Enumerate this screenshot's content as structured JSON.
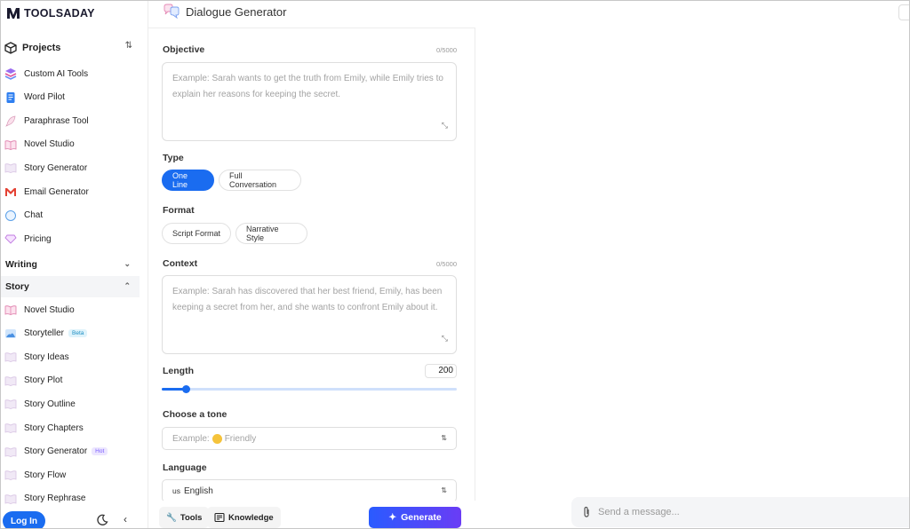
{
  "brand": {
    "name": "TOOLSADAY"
  },
  "header": {
    "title": "Dialogue Generator"
  },
  "sidebar": {
    "projects_label": "Projects",
    "items": [
      {
        "label": "Custom AI Tools",
        "icon": "layers-icon"
      },
      {
        "label": "Word Pilot",
        "icon": "document-icon"
      },
      {
        "label": "Paraphrase Tool",
        "icon": "feather-icon"
      },
      {
        "label": "Novel Studio",
        "icon": "open-book-icon"
      },
      {
        "label": "Story Generator",
        "icon": "book-icon"
      },
      {
        "label": "Email Generator",
        "icon": "gmail-icon"
      },
      {
        "label": "Chat",
        "icon": "chat-bubble-icon"
      },
      {
        "label": "Pricing",
        "icon": "diamond-icon"
      }
    ],
    "sections": [
      {
        "label": "Writing",
        "expanded": false
      },
      {
        "label": "Story",
        "expanded": true
      }
    ],
    "story_items": [
      {
        "label": "Novel Studio",
        "icon": "open-book-icon",
        "badge": ""
      },
      {
        "label": "Storyteller",
        "icon": "storyteller-icon",
        "badge": "Beta"
      },
      {
        "label": "Story Ideas",
        "icon": "book-icon",
        "badge": ""
      },
      {
        "label": "Story Plot",
        "icon": "book-icon",
        "badge": ""
      },
      {
        "label": "Story Outline",
        "icon": "book-icon",
        "badge": ""
      },
      {
        "label": "Story Chapters",
        "icon": "book-icon",
        "badge": ""
      },
      {
        "label": "Story Generator",
        "icon": "book-icon",
        "badge": "Hot"
      },
      {
        "label": "Story Flow",
        "icon": "book-icon",
        "badge": ""
      },
      {
        "label": "Story Rephrase",
        "icon": "book-icon",
        "badge": ""
      }
    ],
    "login_label": "Log In"
  },
  "form": {
    "objective": {
      "label": "Objective",
      "counter": "0/5000",
      "placeholder": "Example: Sarah wants to get the truth from Emily, while Emily tries to explain her reasons for keeping the secret."
    },
    "type": {
      "label": "Type",
      "options": [
        "One Line",
        "Full Conversation"
      ],
      "selected": "One Line"
    },
    "format": {
      "label": "Format",
      "options": [
        "Script Format",
        "Narrative Style"
      ]
    },
    "context": {
      "label": "Context",
      "counter": "0/5000",
      "placeholder": "Example: Sarah has discovered that her best friend, Emily, has been keeping a secret from her, and she wants to confront Emily about it."
    },
    "length": {
      "label": "Length",
      "value": "200",
      "fraction": 0.08
    },
    "tone": {
      "label": "Choose a tone",
      "placeholder_prefix": "Example:",
      "placeholder_value": "Friendly"
    },
    "language": {
      "label": "Language",
      "code": "us",
      "value": "English"
    }
  },
  "bottom": {
    "tools_label": "Tools",
    "knowledge_label": "Knowledge",
    "generate_label": "Generate"
  },
  "chat": {
    "placeholder": "Send a message..."
  },
  "colors": {
    "accent": "#1a6cf0",
    "generate_start": "#2a5bff",
    "generate_end": "#6a3cf5"
  }
}
